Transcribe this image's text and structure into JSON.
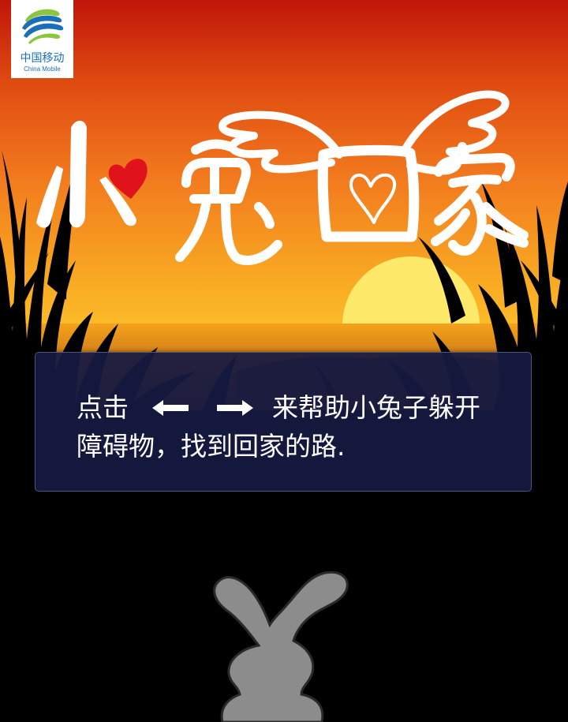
{
  "app": {
    "title": "小兔回家",
    "brand_cn": "中国移动",
    "brand_en": "China Mobile"
  },
  "instructions": {
    "prefix": "点击",
    "left_key_icon": "arrow-left-icon",
    "right_key_icon": "arrow-right-icon",
    "line1_suffix": "来帮助小兔子躲开",
    "line2": "障碍物，找到回家的路."
  },
  "colors": {
    "sky_top": "#c51a00",
    "sky_mid": "#f2741d",
    "sky_horizon": "#fbb51e",
    "sun": "#ffe96a",
    "heart": "#e0131c",
    "panel_bg": "#161a42",
    "rabbit": "#8c8c8c",
    "logo_blue": "#1a6fb8",
    "logo_green": "#8cc63f"
  },
  "player": {
    "icon": "rabbit-icon"
  }
}
